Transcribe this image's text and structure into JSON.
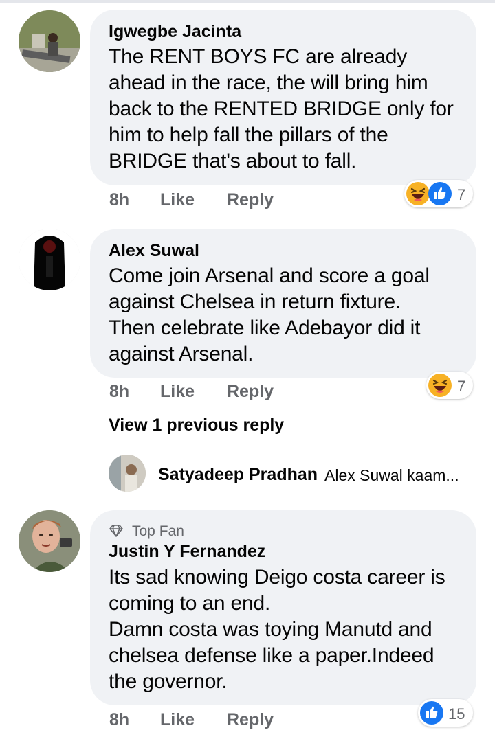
{
  "comments": [
    {
      "author": "Igwegbe Jacinta",
      "lines": [
        "The RENT BOYS FC are already",
        "ahead in the race, the will bring him",
        "back to the RENTED BRIDGE only for",
        "him to help fall the pillars of the",
        "BRIDGE that's about to fall."
      ],
      "time": "8h",
      "like_label": "Like",
      "reply_label": "Reply",
      "reactions": [
        "haha",
        "like"
      ],
      "reaction_count": "7"
    },
    {
      "author": "Alex Suwal",
      "lines": [
        "Come join Arsenal and score a goal",
        "against Chelsea in return fixture.",
        "Then celebrate like Adebayor did it",
        "against Arsenal."
      ],
      "time": "8h",
      "like_label": "Like",
      "reply_label": "Reply",
      "reactions": [
        "haha"
      ],
      "reaction_count": "7",
      "view_previous": "View 1 previous reply",
      "latest_reply": {
        "author": "Satyadeep Pradhan",
        "snippet": "Alex Suwal  kaam..."
      }
    },
    {
      "badge": "Top Fan",
      "author": "Justin Y Fernandez",
      "lines": [
        "Its sad knowing Deigo costa career is",
        "coming to an end.",
        "Damn costa was toying Manutd and",
        "chelsea defense like a paper.Indeed",
        "the governor."
      ],
      "time": "8h",
      "like_label": "Like",
      "reply_label": "Reply",
      "reactions": [
        "like"
      ],
      "reaction_count": "15"
    }
  ],
  "colors": {
    "bubble": "#f0f2f5",
    "meta": "#65676b",
    "like_blue": "#1877f2",
    "haha_yellow": "#f7b125"
  }
}
